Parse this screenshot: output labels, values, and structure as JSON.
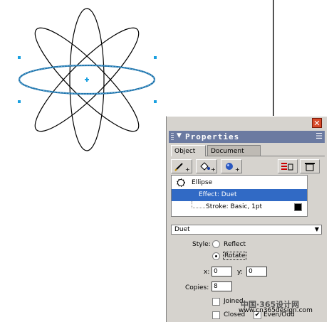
{
  "panel": {
    "title": "Properties",
    "close_glyph": "✕",
    "menu_glyph": "☰",
    "tabs": [
      "Object",
      "Document"
    ],
    "toolbar_icons": [
      "add-stroke-icon",
      "add-fill-icon",
      "add-effect-icon",
      "delete-attribute-icon",
      "trash-icon"
    ],
    "attributes": {
      "object_name": "Ellipse",
      "effect": "Effect: Duet",
      "stroke": "Stroke: Basic, 1pt"
    },
    "effect_select": {
      "value": "Duet"
    },
    "style_label": "Style:",
    "style_options": [
      "Reflect",
      "Rotate"
    ],
    "style_selected": "Rotate",
    "x_label": "x:",
    "x_value": "0",
    "y_label": "y:",
    "y_value": "0",
    "copies_label": "Copies:",
    "copies_value": "8",
    "joined_label": "Joined",
    "closed_label": "Closed",
    "even_label": "Even/Odd",
    "joined_checked": false,
    "closed_checked": false,
    "even_checked": true
  },
  "watermark": {
    "line1": "中国·365设计网",
    "line2": "www.cn365design.com"
  },
  "colors": {
    "titlebar": "#6b7aa1",
    "selection": "#316ac5",
    "panel_bg": "#d6d3ce",
    "selected_path": "#1a6fa8",
    "close_button": "#d84a2a"
  }
}
